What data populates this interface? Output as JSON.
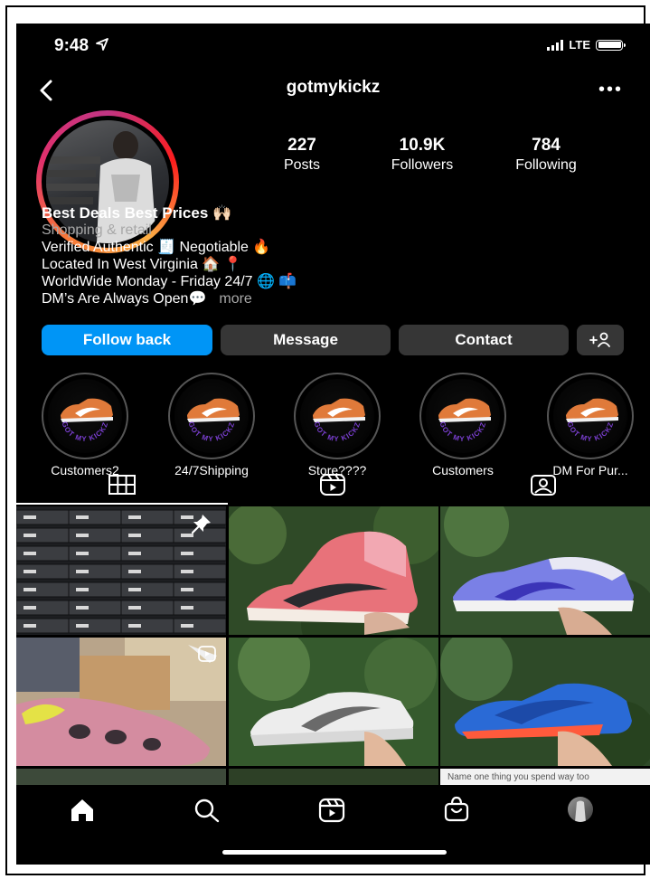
{
  "status": {
    "time": "9:48",
    "network": "LTE"
  },
  "header": {
    "username": "gotmykickz"
  },
  "stats": [
    {
      "value": "227",
      "label": "Posts"
    },
    {
      "value": "10.9K",
      "label": "Followers"
    },
    {
      "value": "784",
      "label": "Following"
    }
  ],
  "bio": {
    "name": "Best Deals Best Prices 🙌🏻",
    "category": "Shopping & retail",
    "lines": [
      "Verified Authentic 🧾 Negotiable 🔥",
      "Located In West Virginia 🏠 📍",
      "WorldWide Monday - Friday 24/7 🌐 📫",
      "DM’s Are Always Open💬"
    ],
    "more": "more"
  },
  "buttons": {
    "follow_back": "Follow back",
    "message": "Message",
    "contact": "Contact"
  },
  "highlights": [
    {
      "label": "Customers2"
    },
    {
      "label": "24/7Shipping"
    },
    {
      "label": "Store????"
    },
    {
      "label": "Customers"
    },
    {
      "label": "DM For Pur..."
    }
  ],
  "highlight_badge_text": "GOT MY KICKZ",
  "grid": {
    "partial_caption": "Name one thing you spend way too"
  },
  "colors": {
    "accent": "#0095f6",
    "button_bg": "#363636",
    "background": "#000000"
  }
}
